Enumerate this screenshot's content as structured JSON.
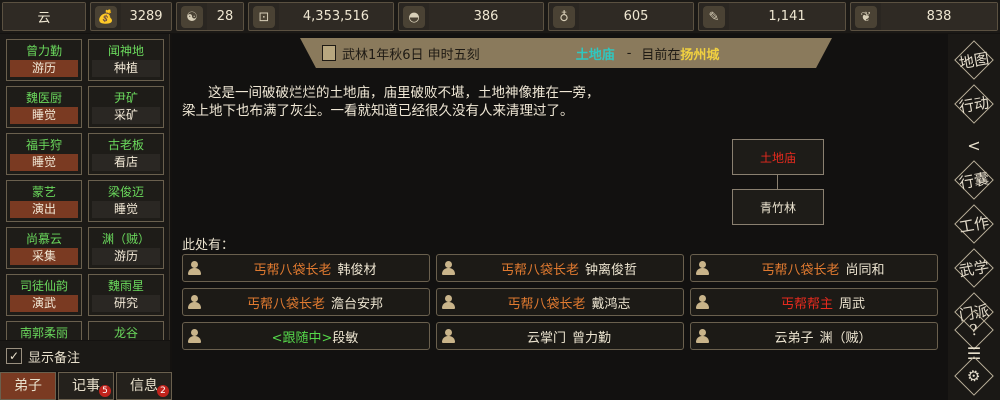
{
  "topbar": {
    "items": [
      {
        "icon": "sect-icon",
        "glyph": "",
        "value": "云"
      },
      {
        "icon": "money-bag-icon",
        "glyph": "💰",
        "value": "3289"
      },
      {
        "icon": "yin-yang-icon",
        "glyph": "☯",
        "value": "28"
      },
      {
        "icon": "coin-icon",
        "glyph": "⊡",
        "value": "4,353,516"
      },
      {
        "icon": "food-bowl-icon",
        "glyph": "◓",
        "value": "386"
      },
      {
        "icon": "gourd-icon",
        "glyph": "♁",
        "value": "605"
      },
      {
        "icon": "scroll-icon",
        "glyph": "✎",
        "value": "1,141"
      },
      {
        "icon": "herb-icon",
        "glyph": "❦",
        "value": "838"
      }
    ]
  },
  "disciples": [
    {
      "name": "曾力勤",
      "activity": "游历",
      "active": true
    },
    {
      "name": "闻神地",
      "activity": "种植",
      "active": false
    },
    {
      "name": "魏医厨",
      "activity": "睡觉",
      "active": true
    },
    {
      "name": "尹矿",
      "activity": "采矿",
      "active": false
    },
    {
      "name": "福手狩",
      "activity": "睡觉",
      "active": true
    },
    {
      "name": "古老板",
      "activity": "看店",
      "active": false
    },
    {
      "name": "蒙艺",
      "activity": "演出",
      "active": true
    },
    {
      "name": "梁俊迈",
      "activity": "睡觉",
      "active": false
    },
    {
      "name": "尚慕云",
      "activity": "采集",
      "active": true
    },
    {
      "name": "渊（贼）",
      "activity": "游历",
      "active": false
    },
    {
      "name": "司徒仙韵",
      "activity": "演武",
      "active": true
    },
    {
      "name": "魏雨星",
      "activity": "研究",
      "active": false
    },
    {
      "name": "南郭柔丽",
      "activity": "",
      "active": true
    },
    {
      "name": "龙谷",
      "activity": "",
      "active": false
    }
  ],
  "notes_toggle": {
    "check": "✓",
    "label": "显示备注"
  },
  "bottom_tabs": [
    {
      "label": "弟子",
      "badge": ""
    },
    {
      "label": "记事",
      "badge": "5"
    },
    {
      "label": "信息",
      "badge": "2"
    }
  ],
  "header": {
    "date": "武林1年秋6日 申时五刻",
    "location": "土地庙",
    "separator": "-",
    "current_prefix": "目前在",
    "city": "扬州城"
  },
  "description": "这是一间破破烂烂的土地庙，庙里破败不堪，土地神像推在一旁，梁上地下也布满了灰尘。一看就知道已经很久没有人来清理过了。",
  "map": {
    "current": "土地庙",
    "neighbor": "青竹林"
  },
  "here_label": "此处有：",
  "npcs": [
    {
      "title": "丐帮八袋长老",
      "name": "韩俊材",
      "title_color": "orange"
    },
    {
      "title": "丐帮八袋长老",
      "name": "钟离俊哲",
      "title_color": "orange"
    },
    {
      "title": "丐帮八袋长老",
      "name": "尚同和",
      "title_color": "orange"
    },
    {
      "title": "丐帮八袋长老",
      "name": "澹台安邦",
      "title_color": "orange"
    },
    {
      "title": "丐帮八袋长老",
      "name": "戴鸿志",
      "title_color": "orange"
    },
    {
      "title": "丐帮帮主",
      "name": "周武",
      "title_color": "red"
    },
    {
      "title": "<跟随中>",
      "name": "段敏",
      "title_color": "green"
    },
    {
      "title": "云掌门",
      "name": "曾力勤",
      "title_color": "white"
    },
    {
      "title": "云弟子",
      "name": "渊（贼）",
      "title_color": "white"
    }
  ],
  "right_menu": [
    {
      "icon": "map-icon",
      "label": "地图"
    },
    {
      "icon": "action-icon",
      "label": "行动"
    },
    {
      "icon": "bag-icon",
      "label": "行囊"
    },
    {
      "icon": "work-icon",
      "label": "工作"
    },
    {
      "icon": "study-icon",
      "label": "武学"
    },
    {
      "icon": "sect-icon",
      "label": "门派"
    },
    {
      "icon": "help-icon",
      "label": "?"
    },
    {
      "icon": "settings-icon",
      "label": "⚙"
    }
  ],
  "collapse_arrow": "<",
  "menu_glyph": "☰",
  "colors": {
    "accent_orange": "#e07a30",
    "accent_red": "#e52a1e",
    "accent_green": "#55d84a",
    "location_cyan": "#2fc7c0",
    "city_yellow": "#f0d040",
    "activity_bg": "#7a3a22"
  }
}
